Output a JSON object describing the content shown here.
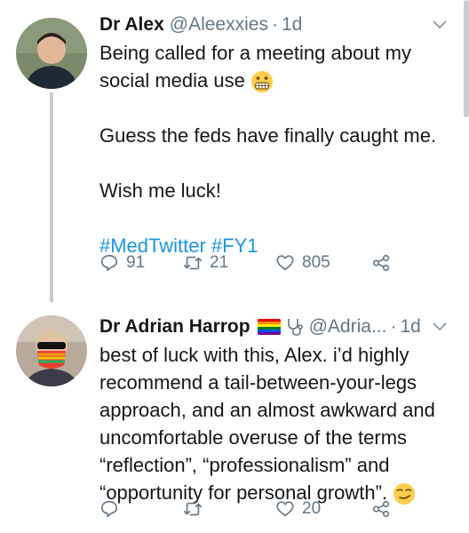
{
  "tweets": [
    {
      "name": "Dr Alex",
      "handle": "@Aleexxies",
      "time": "1d",
      "lines": [
        "Being called for a meeting about my",
        "social media use",
        "Guess the feds have finally caught me.",
        "Wish me luck!"
      ],
      "hashtags": "#MedTwitter #FY1",
      "emoji": "grimacing-face",
      "replies": "91",
      "retweets": "21",
      "likes": "805"
    },
    {
      "name": "Dr Adrian Harrop",
      "handle": "@Adria...",
      "time": "1d",
      "lines": [
        "best of luck with this, Alex. i’d highly",
        "recommend a tail-between-your-legs",
        "approach, and an almost awkward and",
        "uncomfortable overuse of the terms",
        "“reflection”, “professionalism” and",
        "“opportunity for personal growth”."
      ],
      "emoji": "smirking-face",
      "likes": "20"
    }
  ],
  "colors": {
    "accent": "#1b95e0",
    "muted": "#657786",
    "text": "#14171a",
    "thread": "#c5ccd3"
  }
}
